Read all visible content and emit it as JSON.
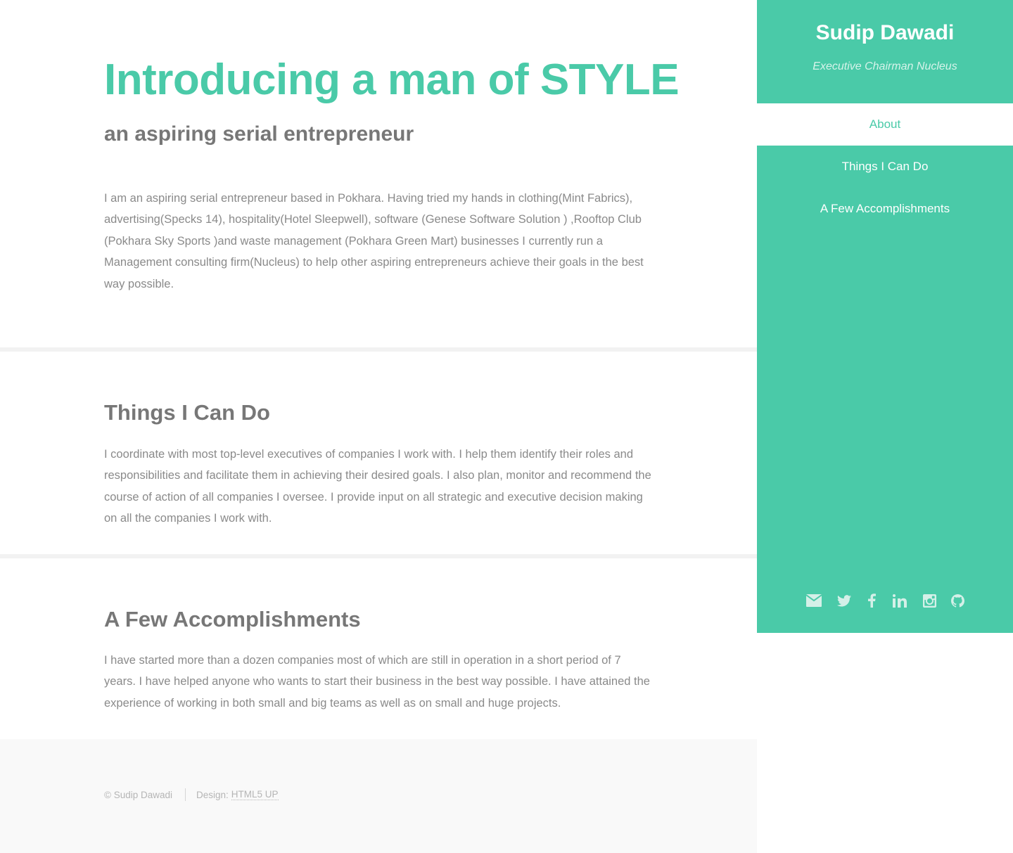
{
  "hero": {
    "title": "Introducing a man of STYLE",
    "subtitle": "an aspiring serial entrepreneur",
    "body": "I am an aspiring serial entrepreneur based in Pokhara. Having tried my hands in clothing(Mint Fabrics), advertising(Specks 14), hospitality(Hotel Sleepwell), software (Genese Software Solution ) ,Rooftop Club (Pokhara Sky Sports )and waste management (Pokhara Green Mart) businesses I currently run a Management consulting firm(Nucleus) to help other aspiring entrepreneurs achieve their goals in the best way possible."
  },
  "things": {
    "title": "Things I Can Do",
    "body": "I coordinate with most top-level executives of companies I work with. I help them identify their roles and responsibilities and facilitate them in achieving their desired goals. I also plan, monitor and recommend the course of action of all companies I oversee. I provide input on all strategic and executive decision making on all the companies I work with."
  },
  "accomplishments": {
    "title": "A Few Accomplishments",
    "body": "I have started more than a dozen companies most of which are still in operation in a short period of 7 years. I have helped anyone who wants to start their business in the best way possible. I have attained the experience of working in both small and big teams as well as on small and huge projects."
  },
  "footer": {
    "copyright": "© Sudip Dawadi",
    "design_label": "Design:",
    "design_link": "HTML5 UP"
  },
  "sidebar": {
    "name": "Sudip Dawadi",
    "role": "Executive Chairman Nucleus",
    "nav": [
      {
        "label": "About",
        "active": true
      },
      {
        "label": "Things I Can Do",
        "active": false
      },
      {
        "label": "A Few Accomplishments",
        "active": false
      }
    ],
    "social_icons": [
      "email-icon",
      "twitter-icon",
      "facebook-icon",
      "linkedin-icon",
      "instagram-icon",
      "github-icon"
    ]
  },
  "colors": {
    "accent": "#4acaa8",
    "heading": "#777777",
    "body_text": "#8a8a8a",
    "footer_bg": "#f9f9f9"
  }
}
